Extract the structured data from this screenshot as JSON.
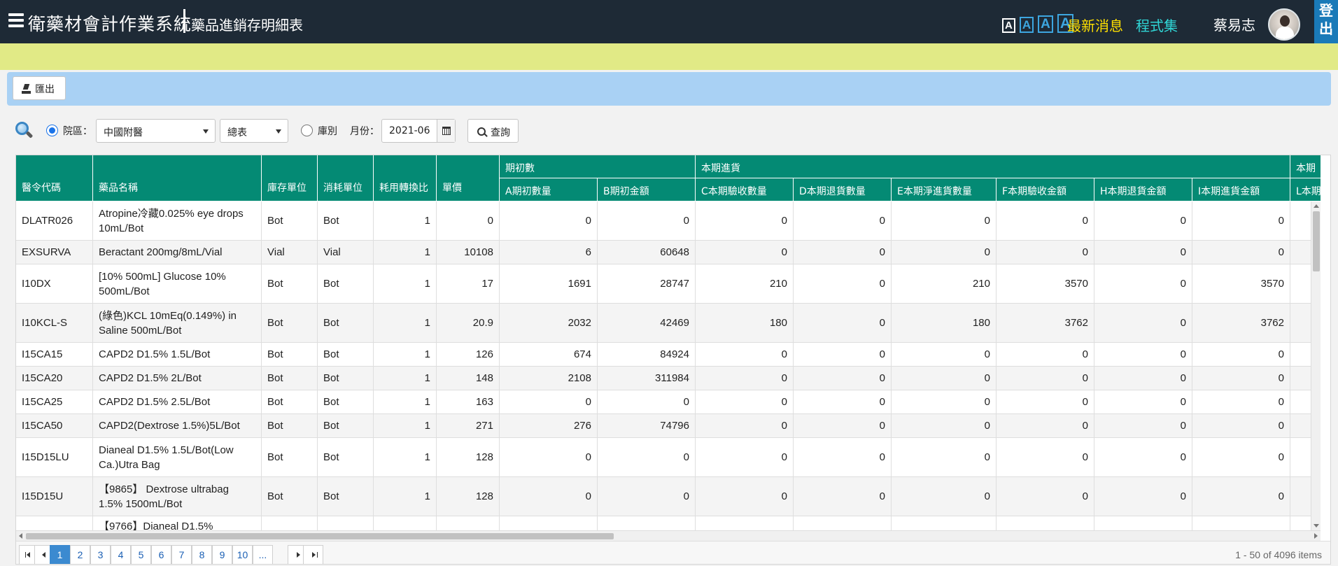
{
  "header": {
    "app_title": "衛藥材會計作業系統",
    "page_title": "藥品進銷存明細表",
    "font_size_options": [
      "A",
      "A",
      "A",
      "A"
    ],
    "news_label": "最新消息",
    "programs_label": "程式集",
    "user_name": "蔡易志",
    "logout_label": "登出"
  },
  "toolbar": {
    "export_label": "匯出"
  },
  "filters": {
    "campus_label": "院區：",
    "campus_checked": true,
    "hospital_value": "中國附醫",
    "report_value": "總表",
    "store_label": "庫別",
    "store_checked": false,
    "month_label": "月份：",
    "month_value": "2021-06",
    "query_label": "查詢"
  },
  "table": {
    "columns": [
      "醫令代碼",
      "藥品名稱",
      "庫存單位",
      "消耗單位",
      "耗用轉換比",
      "單價"
    ],
    "groups": [
      "期初數",
      "本期進貨",
      "本期"
    ],
    "group_columns": [
      "A期初數量",
      "B期初金額",
      "C本期驗收數量",
      "D本期退貨數量",
      "E本期淨進貨數量",
      "F本期驗收金額",
      "H本期退貨金額",
      "I本期進貨金額",
      "L本期"
    ],
    "rows": [
      [
        "DLATR026",
        "Atropine冷藏0.025% eye drops 10mL/Bot",
        "Bot",
        "Bot",
        "1",
        "0",
        "0",
        "0",
        "0",
        "0",
        "0",
        "0",
        "0",
        "0",
        ""
      ],
      [
        "EXSURVA",
        "Beractant 200mg/8mL/Vial",
        "Vial",
        "Vial",
        "1",
        "10108",
        "6",
        "60648",
        "0",
        "0",
        "0",
        "0",
        "0",
        "0",
        ""
      ],
      [
        "I10DX",
        "[10% 500mL] Glucose 10% 500mL/Bot",
        "Bot",
        "Bot",
        "1",
        "17",
        "1691",
        "28747",
        "210",
        "0",
        "210",
        "3570",
        "0",
        "3570",
        ""
      ],
      [
        "I10KCL-S",
        "(綠色)KCL 10mEq(0.149%) in Saline 500mL/Bot",
        "Bot",
        "Bot",
        "1",
        "20.9",
        "2032",
        "42469",
        "180",
        "0",
        "180",
        "3762",
        "0",
        "3762",
        ""
      ],
      [
        "I15CA15",
        "CAPD2 D1.5% 1.5L/Bot",
        "Bot",
        "Bot",
        "1",
        "126",
        "674",
        "84924",
        "0",
        "0",
        "0",
        "0",
        "0",
        "0",
        ""
      ],
      [
        "I15CA20",
        "CAPD2 D1.5% 2L/Bot",
        "Bot",
        "Bot",
        "1",
        "148",
        "2108",
        "311984",
        "0",
        "0",
        "0",
        "0",
        "0",
        "0",
        ""
      ],
      [
        "I15CA25",
        "CAPD2 D1.5% 2.5L/Bot",
        "Bot",
        "Bot",
        "1",
        "163",
        "0",
        "0",
        "0",
        "0",
        "0",
        "0",
        "0",
        "0",
        ""
      ],
      [
        "I15CA50",
        "CAPD2(Dextrose 1.5%)5L/Bot",
        "Bot",
        "Bot",
        "1",
        "271",
        "276",
        "74796",
        "0",
        "0",
        "0",
        "0",
        "0",
        "0",
        ""
      ],
      [
        "I15D15LU",
        "Dianeal D1.5% 1.5L/Bot(Low Ca.)Utra Bag",
        "Bot",
        "Bot",
        "1",
        "128",
        "0",
        "0",
        "0",
        "0",
        "0",
        "0",
        "0",
        "0",
        ""
      ],
      [
        "I15D15U",
        "【9865】 Dextrose ultrabag 1.5% 1500mL/Bot",
        "Bot",
        "Bot",
        "1",
        "128",
        "0",
        "0",
        "0",
        "0",
        "0",
        "0",
        "0",
        "0",
        ""
      ],
      [
        "",
        "【9766】Dianeal D1.5%",
        "",
        "",
        "",
        "",
        "",
        "",
        "",
        "",
        "",
        "",
        "",
        "",
        ""
      ]
    ]
  },
  "pager": {
    "pages": [
      "1",
      "2",
      "3",
      "4",
      "5",
      "6",
      "7",
      "8",
      "9",
      "10",
      "..."
    ],
    "current_page": "1",
    "info": "1 - 50 of 4096 items"
  }
}
